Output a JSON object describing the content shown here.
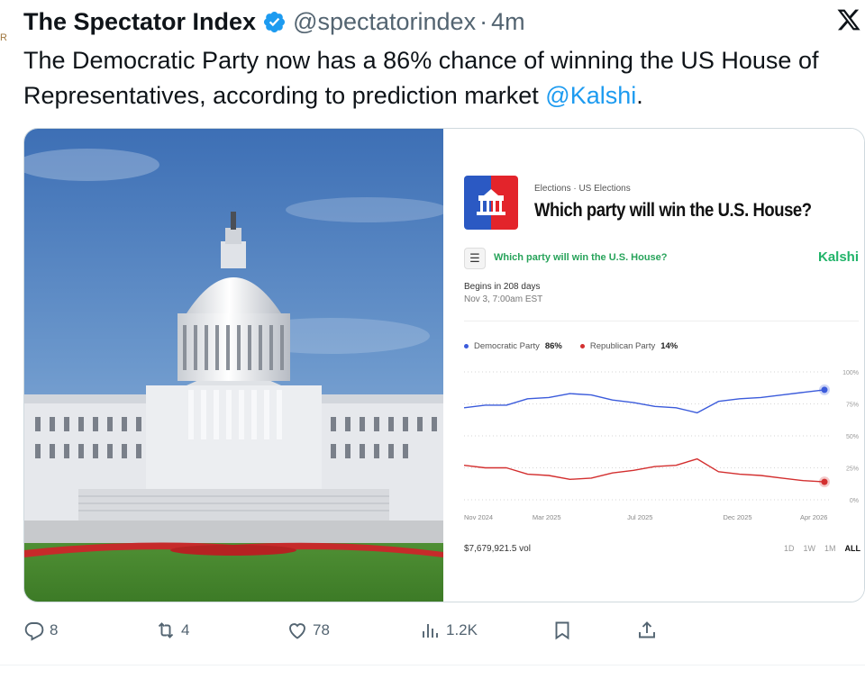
{
  "tweet": {
    "author_name": "The Spectator Index",
    "verified": true,
    "handle": "@spectatorindex",
    "separator": "·",
    "time": "4m",
    "text_before": "The Democratic Party now has a 86% chance of winning the US House of Representatives, according to prediction market ",
    "mention": "@Kalshi",
    "text_after": "."
  },
  "left_stub_text": "R",
  "media": {
    "photo_icon": "capitol-building-photo",
    "card": {
      "crumbs": "Elections  ·  US Elections",
      "title": "Which party will win the U.S. House?",
      "subtitle": "Which party will win the U.S. House?",
      "brand": "Kalshi",
      "begins": "Begins in 208 days",
      "date": "Nov 3, 7:00am EST",
      "legend": {
        "dem_name": "Democratic Party",
        "dem_pct": "86%",
        "rep_name": "Republican Party",
        "rep_pct": "14%"
      },
      "volume": "$7,679,921.5 vol",
      "ranges": [
        "1D",
        "1W",
        "1M",
        "ALL"
      ],
      "active_range": "ALL",
      "colors": {
        "dem": "#3b5bdb",
        "rep": "#d32f2f",
        "brand": "#22b46a"
      }
    }
  },
  "chart_data": {
    "type": "line",
    "x_ticks": [
      "Nov 2024",
      "Mar 2025",
      "Jul 2025",
      "Dec 2025",
      "Apr 2026"
    ],
    "y_ticks": [
      "100%",
      "75%",
      "50%",
      "25%",
      "0%"
    ],
    "ylim": [
      0,
      100
    ],
    "x_index_range": [
      0,
      17
    ],
    "grid": true,
    "series": [
      {
        "name": "Democratic Party",
        "color": "#3b5bdb",
        "x": [
          0,
          1,
          2,
          3,
          4,
          5,
          6,
          7,
          8,
          9,
          10,
          11,
          12,
          13,
          14,
          15,
          16,
          17
        ],
        "values": [
          72,
          74,
          74,
          79,
          80,
          83,
          82,
          78,
          76,
          73,
          72,
          68,
          77,
          79,
          80,
          82,
          84,
          86
        ]
      },
      {
        "name": "Republican Party",
        "color": "#d32f2f",
        "x": [
          0,
          1,
          2,
          3,
          4,
          5,
          6,
          7,
          8,
          9,
          10,
          11,
          12,
          13,
          14,
          15,
          16,
          17
        ],
        "values": [
          27,
          25,
          25,
          20,
          19,
          16,
          17,
          21,
          23,
          26,
          27,
          32,
          22,
          20,
          19,
          17,
          15,
          14
        ]
      }
    ]
  },
  "actions": {
    "replies": "8",
    "reposts": "4",
    "likes": "78",
    "views": "1.2K"
  }
}
